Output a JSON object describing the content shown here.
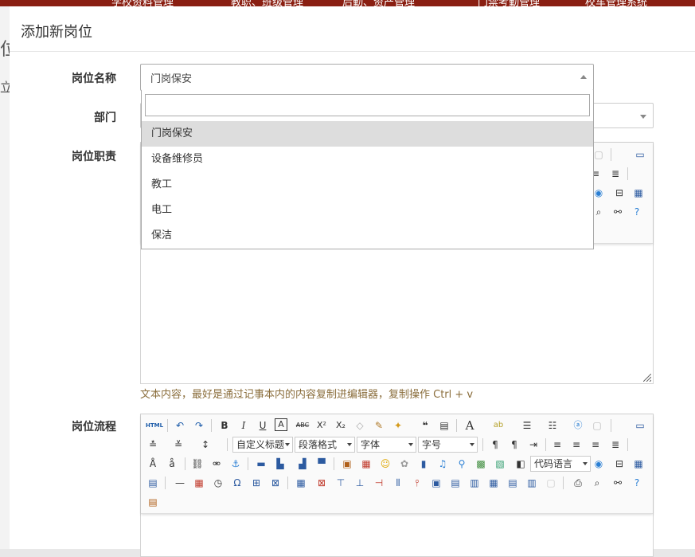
{
  "background": {
    "top_nav": [
      "学校资料管理",
      "教职、班级管理",
      "后勤、资产管理",
      "门禁考勤管理",
      "校车管理系统"
    ],
    "left_glyph_1": "位",
    "left_glyph_2": "立"
  },
  "modal": {
    "title": "添加新岗位",
    "fields": {
      "position_name_label": "岗位名称",
      "position_name_value": "门岗保安",
      "department_label": "部门",
      "duties_label": "岗位职责",
      "process_label": "岗位流程"
    },
    "dropdown": {
      "search_value": "",
      "options": [
        "门岗保安",
        "设备维修员",
        "教工",
        "电工",
        "保洁"
      ],
      "selected_index": 0
    },
    "editor_hint": "文本内容，最好是通过记事本内的内容复制进编辑器，复制操作 Ctrl + v",
    "toolbar": {
      "source_label": "HTML",
      "bold": "B",
      "italic": "I",
      "underline": "U",
      "border_font": "A",
      "strike": "ABC",
      "superscript": "X²",
      "subscript": "X₂",
      "quote": "❝",
      "font_color": "A",
      "custom_title": "自定义标题",
      "paragraph": "段落格式",
      "font_family": "字体",
      "font_size": "字号",
      "code_lang": "代码语言",
      "omega": "Ω",
      "help": "?"
    }
  },
  "colors": {
    "top_nav_bg": "#8a1f12",
    "hint_color": "#8a6d3b",
    "selected_option_bg": "#dddddd"
  }
}
